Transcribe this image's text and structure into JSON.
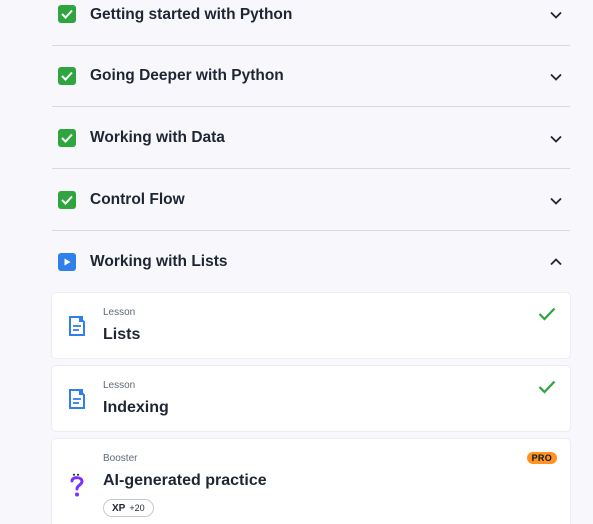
{
  "sections": [
    {
      "title": "Getting started with Python",
      "status": "done",
      "expanded": false
    },
    {
      "title": "Going Deeper with Python",
      "status": "done",
      "expanded": false
    },
    {
      "title": "Working with Data",
      "status": "done",
      "expanded": false
    },
    {
      "title": "Control Flow",
      "status": "done",
      "expanded": false
    },
    {
      "title": "Working with Lists",
      "status": "active",
      "expanded": true
    }
  ],
  "items": [
    {
      "kind": "Lesson",
      "title": "Lists",
      "completed": true,
      "icon": "lesson-document-icon"
    },
    {
      "kind": "Lesson",
      "title": "Indexing",
      "completed": true,
      "icon": "lesson-document-icon"
    },
    {
      "kind": "Booster",
      "title": "AI-generated practice",
      "badge": "PRO",
      "xp_label": "XP",
      "xp_value": "+20",
      "icon": "question-mark-icon"
    }
  ],
  "colors": {
    "done_green": "#2fa53f",
    "active_blue": "#2f80ed",
    "pro_orange": "#ff931e",
    "lesson_icon_blue": "#2f80ed",
    "booster_purple": "#7933ff"
  }
}
